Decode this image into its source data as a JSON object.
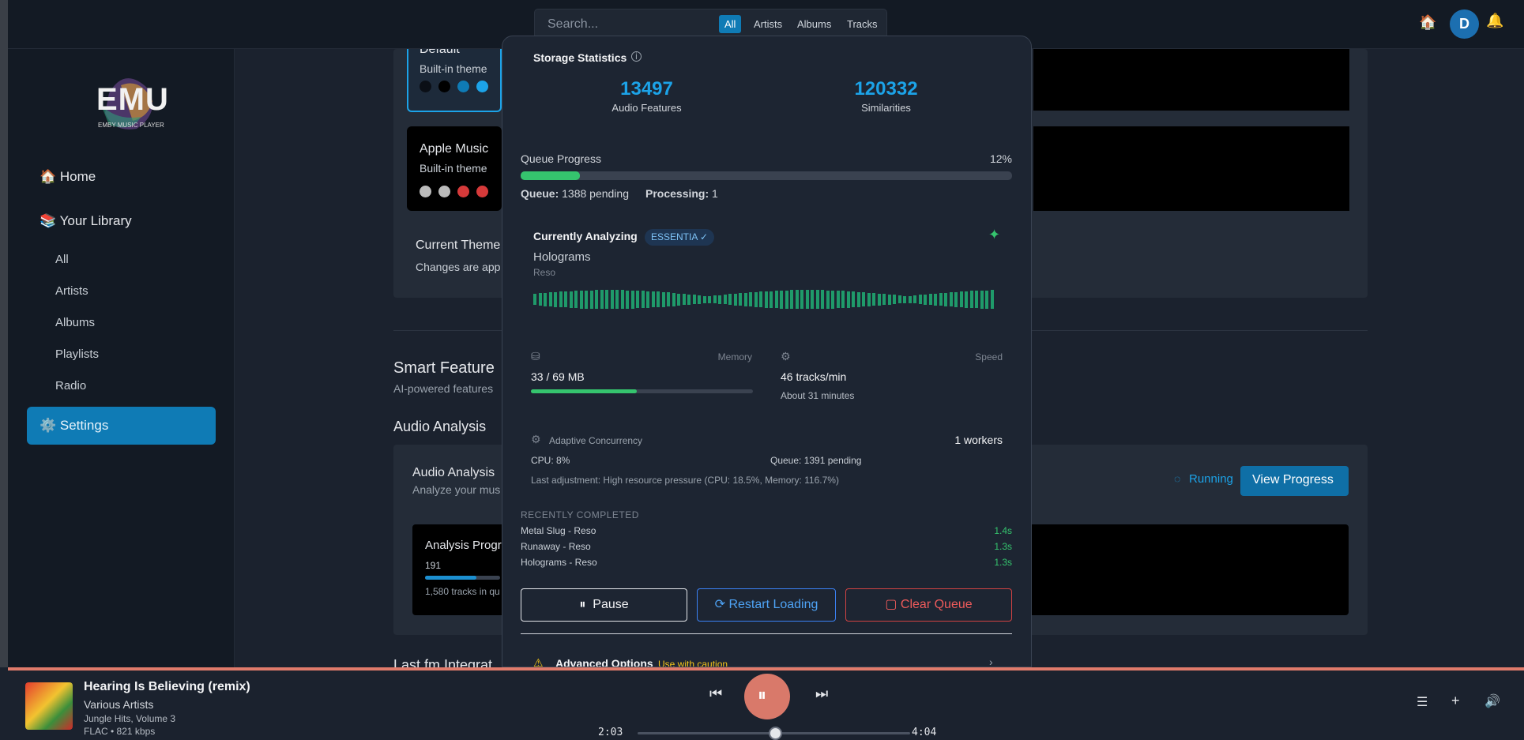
{
  "search": {
    "placeholder": "Search...",
    "filters": [
      "All",
      "Artists",
      "Albums",
      "Tracks"
    ]
  },
  "sidebar": {
    "logo_text": "EMU",
    "logo_sub": "EMBY MUSIC PLAYER",
    "home": "🏠 Home",
    "library": "📚 Your Library",
    "subitems": [
      "All",
      "Artists",
      "Albums",
      "Playlists",
      "Radio"
    ],
    "settings": "⚙️ Settings"
  },
  "header": {
    "avatar_letter": "D",
    "home_icon": "home-icon",
    "bell_icon": "bell-icon"
  },
  "main": {
    "theme_default": {
      "title": "Default",
      "sub": "Built-in theme"
    },
    "theme_apple": {
      "title": "Apple Music",
      "sub": "Built-in theme"
    },
    "current_theme": "Current Theme",
    "current_theme_sub": "Changes are app",
    "smart_title": "Smart Feature",
    "smart_sub": "AI-powered features",
    "audio_title": "Audio Analysis",
    "audio_card_title": "Audio Analysis",
    "audio_card_sub": "Analyze your mus",
    "running": "Running",
    "view_progress": "View Progress",
    "analysis_progress": "Analysis Progr",
    "analysis_count": "191",
    "analysis_tracks": "1,580 tracks in qu",
    "lastfm": "Last.fm Integrat"
  },
  "modal": {
    "title": "Storage Statistics",
    "stat1_value": "13497",
    "stat1_label": "Audio Features",
    "stat2_value": "120332",
    "stat2_label": "Similarities",
    "queue_label": "Queue Progress",
    "queue_pct": "12%",
    "queue_fraction": 0.12,
    "queue_pending_label": "Queue:",
    "queue_pending": "1388 pending",
    "processing_label": "Processing:",
    "processing": "1",
    "analyzing_title": "Currently Analyzing",
    "engine": "ESSENTIA ✓",
    "track": "Holograms",
    "artist": "Reso",
    "memory_label": "Memory",
    "memory_value": "33 / 69 MB",
    "memory_fraction": 0.478,
    "speed_label": "Speed",
    "speed_value": "46 tracks/min",
    "speed_eta": "About 31 minutes",
    "adaptive_label": "Adaptive Concurrency",
    "workers": "1 workers",
    "cpu": "CPU: 8%",
    "queue_pending2": "Queue: 1391 pending",
    "last_adjust": "Last adjustment: High resource pressure (CPU: 18.5%, Memory: 116.7%)",
    "recent_title": "RECENTLY COMPLETED",
    "recent": [
      {
        "name": "Metal Slug - Reso",
        "time": "1.4s"
      },
      {
        "name": "Runaway - Reso",
        "time": "1.3s"
      },
      {
        "name": "Holograms - Reso",
        "time": "1.3s"
      }
    ],
    "pause": "Pause",
    "restart": "Restart Loading",
    "clear": "Clear Queue",
    "advanced": "Advanced Options",
    "advanced_warn": "Use with caution"
  },
  "player": {
    "title": "Hearing Is Believing (remix)",
    "artist": "Various Artists",
    "album": "Jungle Hits, Volume 3",
    "format": "FLAC • 821 kbps",
    "elapsed": "2:03",
    "duration": "4:04",
    "progress_fraction": 0.504
  },
  "colors": {
    "accent": "#0f7bb5",
    "stat": "#1ca3e8",
    "green": "#35c46e",
    "player_accent": "#d9796a"
  }
}
